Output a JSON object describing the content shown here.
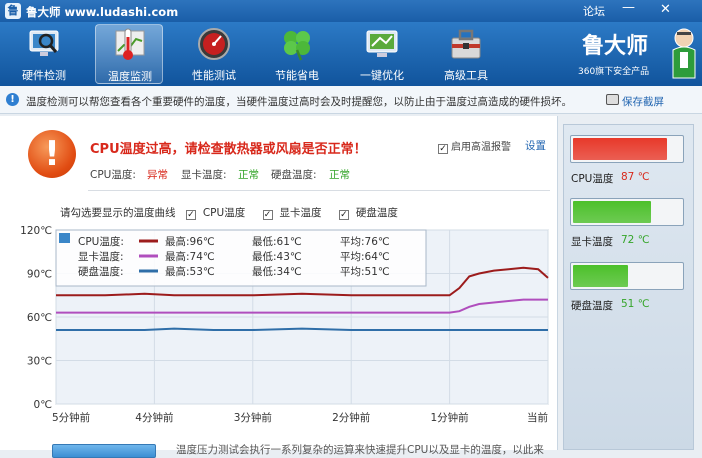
{
  "window": {
    "title": "鲁大师 www.ludashi.com",
    "forum": "论坛"
  },
  "toolbar": {
    "items": [
      {
        "label": "硬件检测",
        "icon": "magnifier-monitor-icon"
      },
      {
        "label": "温度监测",
        "icon": "thermometer-icon",
        "active": true
      },
      {
        "label": "性能测试",
        "icon": "speedometer-icon"
      },
      {
        "label": "节能省电",
        "icon": "clover-icon"
      },
      {
        "label": "一键优化",
        "icon": "screen-optimize-icon"
      },
      {
        "label": "高级工具",
        "icon": "toolbox-icon"
      }
    ]
  },
  "brand": {
    "name": "鲁大师",
    "sub": "360旗下安全产品"
  },
  "info": {
    "text": "温度检测可以帮您查看各个重要硬件的温度，当硬件温度过高时会及时提醒您，以防止由于温度过高造成的硬件损坏。",
    "save": "保存截屏"
  },
  "alert": {
    "title": "CPU温度过高，请检查散热器或风扇是否正常！",
    "cpu_label": "CPU温度:",
    "cpu_status": "异常",
    "gpu_label": "显卡温度:",
    "gpu_status": "正常",
    "disk_label": "硬盘温度:",
    "disk_status": "正常",
    "enable_alarm": "启用高温报警",
    "settings": "设置"
  },
  "curve_select": {
    "prompt": "请勾选要显示的温度曲线",
    "cpu": "CPU温度",
    "gpu": "显卡温度",
    "disk": "硬盘温度"
  },
  "colors": {
    "cpu": "#9c1c1c",
    "gpu": "#b04ebd",
    "disk": "#2f6ea8",
    "alert_red": "#d8291c",
    "ok_green": "#35a52a"
  },
  "chart_data": {
    "type": "line",
    "y_ticks": [
      "120℃",
      "90℃",
      "60℃",
      "30℃",
      "0℃"
    ],
    "x_ticks": [
      "5分钟前",
      "4分钟前",
      "3分钟前",
      "2分钟前",
      "1分钟前",
      "当前"
    ],
    "ylim": [
      0,
      120
    ],
    "x": [
      -5,
      -4.5,
      -4.1,
      -3.8,
      -3.4,
      -3,
      -2.5,
      -2,
      -1.5,
      -1,
      -0.9,
      -0.8,
      -0.7,
      -0.55,
      -0.4,
      -0.25,
      -0.1,
      0
    ],
    "series": [
      {
        "name": "CPU温度",
        "color": "#9c1c1c",
        "values": [
          75,
          75,
          76,
          75,
          75,
          75,
          76,
          75,
          75,
          75,
          80,
          88,
          90,
          92,
          93,
          94,
          93,
          87
        ]
      },
      {
        "name": "显卡温度",
        "color": "#b04ebd",
        "values": [
          63,
          63,
          63,
          63,
          63,
          63,
          63,
          63,
          63,
          63,
          64,
          67,
          69,
          70,
          71,
          72,
          72,
          72
        ]
      },
      {
        "name": "硬盘温度",
        "color": "#2f6ea8",
        "values": [
          51,
          51,
          51,
          52,
          51,
          51,
          52,
          51,
          51,
          51,
          51,
          51,
          51,
          51,
          51,
          51,
          51,
          51
        ]
      }
    ],
    "legend": [
      {
        "label": "CPU温度:",
        "max": "最高:96℃",
        "min": "最低:61℃",
        "avg": "平均:76℃"
      },
      {
        "label": "显卡温度:",
        "max": "最高:74℃",
        "min": "最低:43℃",
        "avg": "平均:64℃"
      },
      {
        "label": "硬盘温度:",
        "max": "最高:53℃",
        "min": "最低:34℃",
        "avg": "平均:51℃"
      }
    ]
  },
  "side": {
    "cpu": {
      "label": "CPU温度",
      "value": "87 ℃",
      "level": 0.87,
      "color": "#e8392a"
    },
    "gpu": {
      "label": "显卡温度",
      "value": "72 ℃",
      "level": 0.72,
      "color": "#4cc02a"
    },
    "disk": {
      "label": "硬盘温度",
      "value": "51 ℃",
      "level": 0.51,
      "color": "#4cc02a"
    }
  },
  "bottom": {
    "text": "温度压力测试会执行一系列复杂的运算来快速提升CPU以及显卡的温度，以此来"
  }
}
